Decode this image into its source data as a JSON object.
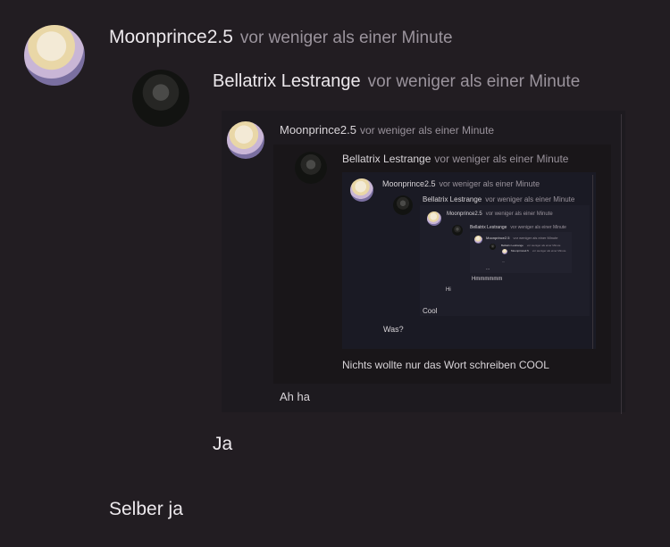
{
  "comments": {
    "moon": {
      "user": "Moonprince2.5",
      "time": "vor weniger als einer Minute"
    },
    "bella": {
      "user": "Bellatrix Lestrange",
      "time": "vor weniger als einer Minute"
    }
  },
  "quote": {
    "header_user": "Moonprince2.5",
    "header_time": "vor weniger als einer Minute",
    "inner_user": "Bellatrix Lestrange",
    "inner_time": "vor weniger als einer Minute",
    "lvl3_user": "Moonprince2.5",
    "lvl3_time": "vor weniger als einer Minute",
    "lvl4_user": "Bellatrix Lestrange",
    "lvl4_time": "vor weniger als einer Minute",
    "lvl5_user": "Moonprince2.5",
    "lvl5_time": "vor weniger als einer Minute",
    "lvl6_user": "Bellatrix Lestrange",
    "lvl6_time": "vor weniger als einer Minute",
    "lvl7_user": "Moonprince2.5",
    "lvl7_time": "vor weniger als einer Minute",
    "lvl8_user": "Bellatrix Lestrange",
    "lvl8_time": "vor weniger als einer Minute",
    "lvl9_user": "Moonprince2.5",
    "lvl9_time": "vor weniger als einer Minute",
    "tiny_msg1": "...",
    "tiny_msg2": "...",
    "msg_ja": "Ja",
    "msg_hmm": "Hmmmmmm",
    "msg_hi": "Hi",
    "msg_cool": "Cool",
    "msg_was": "Was?",
    "msg_nichts": "Nichts wollte nur das Wort schreiben COOL",
    "msg_ahha": "Ah ha"
  },
  "replies": {
    "ja": "Ja",
    "selber": "Selber ja"
  }
}
